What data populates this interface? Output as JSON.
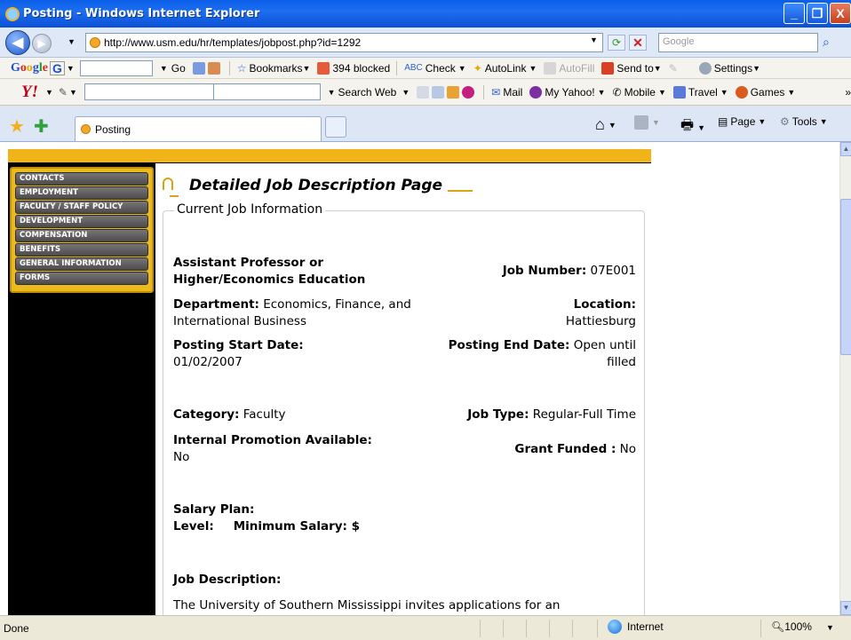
{
  "window": {
    "title": "Posting - Windows Internet Explorer",
    "minimize": "_",
    "maximize": "❐",
    "close": "X"
  },
  "address_bar": {
    "url": "http://www.usm.edu/hr/templates/jobpost.php?id=1292",
    "search_placeholder": "Google"
  },
  "google_toolbar": {
    "logo": [
      "G",
      "o",
      "o",
      "g",
      "l",
      "e"
    ],
    "go_label": "Go",
    "bookmarks_label": "Bookmarks",
    "blocked_label": "394 blocked",
    "check_label": "Check",
    "autolink_label": "AutoLink",
    "autofill_label": "AutoFill",
    "sendto_label": "Send to",
    "settings_label": "Settings"
  },
  "yahoo_toolbar": {
    "logo": "Y!",
    "search_web_label": "Search Web",
    "mail_label": "Mail",
    "my_yahoo_label": "My Yahoo!",
    "mobile_label": "Mobile",
    "travel_label": "Travel",
    "games_label": "Games",
    "more": "»"
  },
  "tabs": {
    "active_label": "Posting",
    "page_label": "Page",
    "tools_label": "Tools"
  },
  "sidebar": {
    "items": [
      {
        "label": "CONTACTS"
      },
      {
        "label": "EMPLOYMENT"
      },
      {
        "label": "FACULTY / STAFF POLICY"
      },
      {
        "label": "DEVELOPMENT"
      },
      {
        "label": "COMPENSATION"
      },
      {
        "label": "BENEFITS"
      },
      {
        "label": "GENERAL INFORMATION"
      },
      {
        "label": "FORMS"
      }
    ]
  },
  "page": {
    "heading": "Detailed Job Description Page",
    "section_legend": "Current Job Information",
    "job_title_line1": "Assistant Professor or",
    "job_title_line2": "Higher/Economics Education",
    "job_number_label": "Job Number:",
    "job_number": "07E001",
    "department_label": "Department:",
    "department_line1": "Economics, Finance, and",
    "department_line2": "International Business",
    "location_label": "Location:",
    "location": "Hattiesburg",
    "posting_start_label": "Posting Start Date:",
    "posting_start": "01/02/2007",
    "posting_end_label": "Posting End Date:",
    "posting_end_line1": "Open until",
    "posting_end_line2": "filled",
    "category_label": "Category:",
    "category": "Faculty",
    "job_type_label": "Job Type:",
    "job_type": "Regular-Full Time",
    "internal_promo_label": "Internal Promotion Available:",
    "internal_promo": "No",
    "grant_funded_label": "Grant Funded :",
    "grant_funded": "No",
    "salary_plan_label": "Salary Plan:",
    "level_label": "Level:",
    "min_salary_label": "Minimum Salary: $",
    "job_description_label": "Job Description:",
    "job_description_text": "The University of Southern Mississippi invites applications for an"
  },
  "status_bar": {
    "status": "Done",
    "zone": "Internet",
    "zoom": "100%"
  }
}
